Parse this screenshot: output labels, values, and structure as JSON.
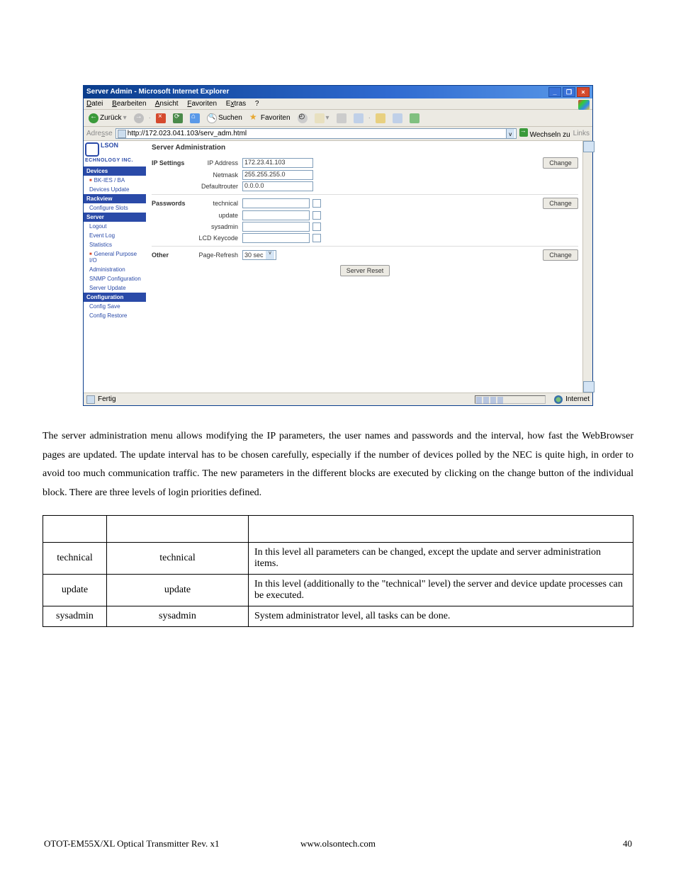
{
  "ie": {
    "title": "Server Admin - Microsoft Internet Explorer",
    "menu": {
      "datei": "Datei",
      "bearbeiten": "Bearbeiten",
      "ansicht": "Ansicht",
      "favoriten": "Favoriten",
      "extras": "Extras",
      "hilfe": "?"
    },
    "toolbar": {
      "back": "Zurück",
      "suchen": "Suchen",
      "favoriten": "Favoriten"
    },
    "addr": {
      "label": "Adresse",
      "url": "http://172.023.041.103/serv_adm.html",
      "go": "Wechseln zu",
      "links": "Links"
    },
    "status": {
      "left": "Fertig",
      "right": "Internet"
    }
  },
  "logo": {
    "line1": "LSON",
    "line2": "ECHNOLOGY INC."
  },
  "nav": {
    "devices_hdr": "Devices",
    "devices": {
      "bkies": "BK-IES / BA",
      "devupd": "Devices Update"
    },
    "rackview_hdr": "Rackview",
    "rackview": {
      "cfgslots": "Configure Slots"
    },
    "server_hdr": "Server",
    "server": {
      "logout": "Logout",
      "eventlog": "Event Log",
      "stats": "Statistics",
      "gpio": "General Purpose I/O",
      "admin": "Administration",
      "snmp": "SNMP Configuration",
      "srvupd": "Server Update"
    },
    "config_hdr": "Configuration",
    "config": {
      "save": "Config Save",
      "restore": "Config Restore"
    }
  },
  "admin": {
    "heading": "Server Administration",
    "ip": {
      "group": "IP Settings",
      "ipaddr_lbl": "IP Address",
      "ipaddr_val": "172.23.41.103",
      "netmask_lbl": "Netmask",
      "netmask_val": "255.255.255.0",
      "router_lbl": "Defaultrouter",
      "router_val": "0.0.0.0",
      "change": "Change"
    },
    "pw": {
      "group": "Passwords",
      "tech_lbl": "technical",
      "upd_lbl": "update",
      "sys_lbl": "sysadmin",
      "lcd_lbl": "LCD Keycode",
      "change": "Change"
    },
    "other": {
      "group": "Other",
      "refresh_lbl": "Page-Refresh",
      "refresh_val": "30 sec",
      "change": "Change",
      "reset": "Server Reset"
    }
  },
  "body": {
    "p1": "The server administration menu allows modifying the IP parameters, the user names and passwords and the interval, how fast the WebBrowser pages are updated. The update interval has to be chosen carefully, especially if the number of devices polled by the NEC is quite high, in order to avoid too much communication traffic. The new parameters in the different blocks are executed by clicking on the change button of the individual block. There are three levels of login priorities defined."
  },
  "table": {
    "rows": [
      {
        "name": "technical",
        "pw": "technical",
        "desc": "In this level all parameters can be changed, except the update and server administration items."
      },
      {
        "name": "update",
        "pw": "update",
        "desc": "In this level (additionally to the \"technical\" level) the server and device update processes can be executed."
      },
      {
        "name": "sysadmin",
        "pw": "sysadmin",
        "desc": "System administrator level, all tasks can be done."
      }
    ]
  },
  "footer": {
    "left": "OTOT-EM55X/XL Optical Transmitter Rev. x1",
    "center": "www.olsontech.com",
    "right": "40"
  }
}
